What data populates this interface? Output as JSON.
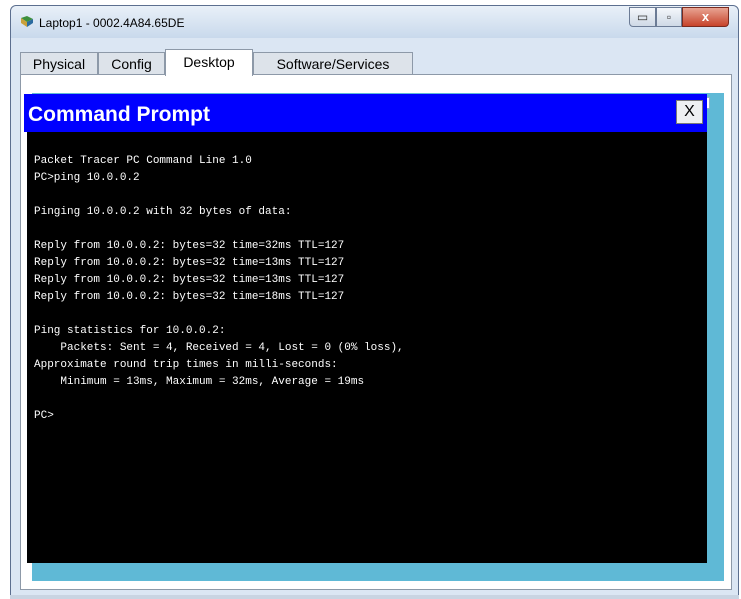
{
  "window": {
    "title": "Laptop1 - 0002.4A84.65DE",
    "controls": {
      "minimize": "▭",
      "maximize": "▫",
      "close": "x"
    }
  },
  "tabs": [
    {
      "label": "Physical"
    },
    {
      "label": "Config"
    },
    {
      "label": "Desktop",
      "active": true
    },
    {
      "label": "Software/Services"
    }
  ],
  "command_prompt": {
    "title": "Command Prompt",
    "close_label": "X",
    "output": "Packet Tracer PC Command Line 1.0\nPC>ping 10.0.0.2\n\nPinging 10.0.0.2 with 32 bytes of data:\n\nReply from 10.0.0.2: bytes=32 time=32ms TTL=127\nReply from 10.0.0.2: bytes=32 time=13ms TTL=127\nReply from 10.0.0.2: bytes=32 time=13ms TTL=127\nReply from 10.0.0.2: bytes=32 time=18ms TTL=127\n\nPing statistics for 10.0.0.2:\n    Packets: Sent = 4, Received = 4, Lost = 0 (0% loss),\nApproximate round trip times in milli-seconds:\n    Minimum = 13ms, Maximum = 32ms, Average = 19ms\n\nPC>"
  },
  "colors": {
    "cmd_titlebar": "#0000ff",
    "terminal_bg": "#000000",
    "terminal_fg": "#ffffff",
    "desktop_bg": "#5fb9d6"
  },
  "icons": {
    "app": "packet-tracer-laptop-icon"
  }
}
